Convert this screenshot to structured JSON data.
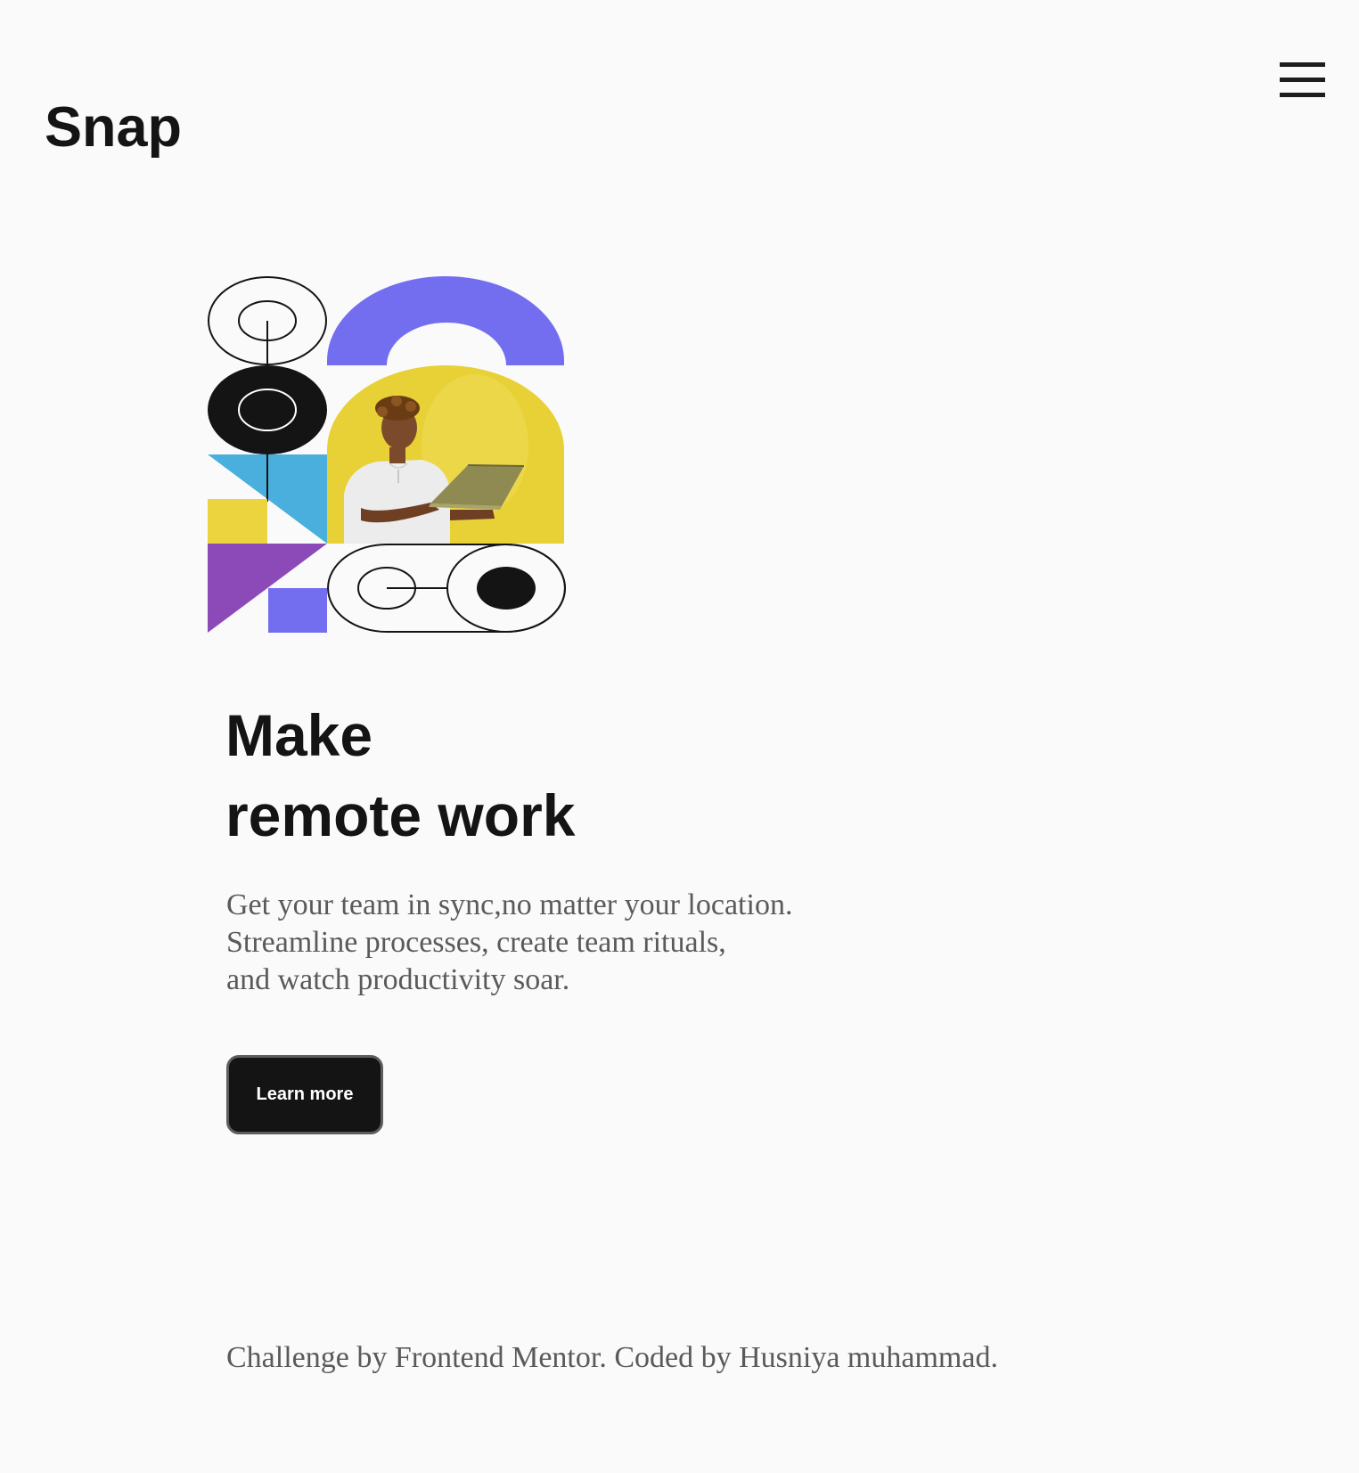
{
  "header": {
    "logo": "Snap",
    "menu_icon": "hamburger-menu-icon"
  },
  "hero": {
    "image_description_icon": "hero-illustration",
    "headline_line1": "Make",
    "headline_line2": "remote work",
    "subtext_line1": "Get your team in sync,no matter your location.",
    "subtext_line2": "Streamline processes, create team rituals,",
    "subtext_line3": "and watch productivity soar.",
    "cta_label": "Learn more"
  },
  "footer": {
    "credit": "Challenge by Frontend Mentor. Coded by Husniya muhammad."
  },
  "colors": {
    "background": "#fafafa",
    "text_dark": "#141414",
    "text_muted": "#5a5a5a",
    "purple": "#736ef0",
    "violet": "#8c4ab8",
    "blue": "#4aafdc",
    "yellow": "#ecd43f"
  }
}
